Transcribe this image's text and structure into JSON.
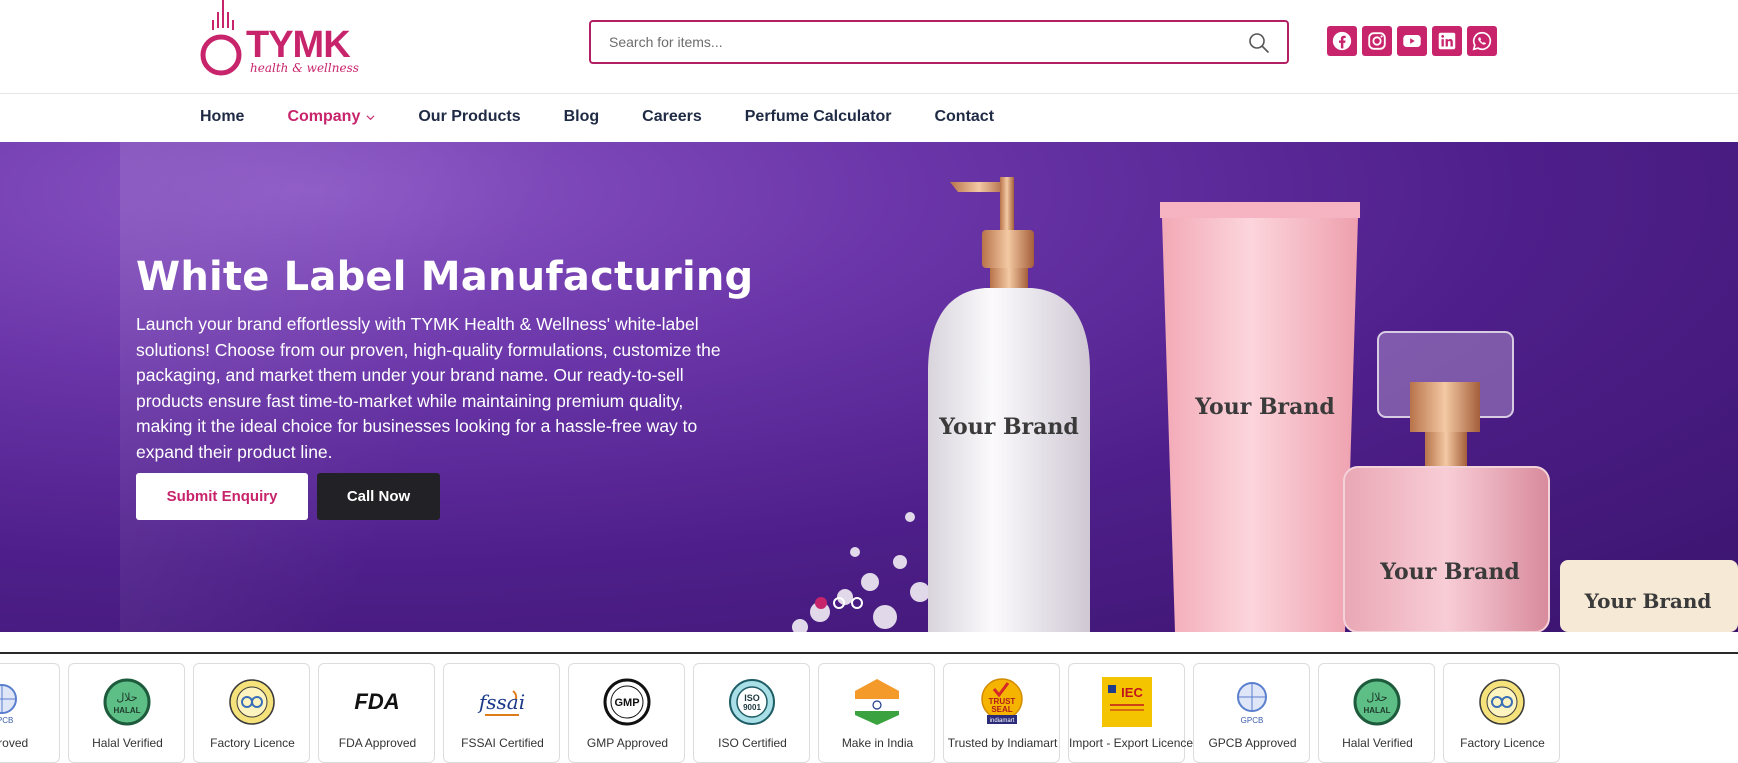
{
  "brand": {
    "name": "TYMK",
    "tagline": "health & wellness",
    "accent": "#c8246c"
  },
  "search": {
    "placeholder": "Search for items..."
  },
  "socials": [
    "facebook-icon",
    "instagram-icon",
    "youtube-icon",
    "linkedin-icon",
    "whatsapp-icon"
  ],
  "nav": {
    "items": [
      {
        "label": "Home"
      },
      {
        "label": "Company"
      },
      {
        "label": "Our Products"
      },
      {
        "label": "Blog"
      },
      {
        "label": "Careers"
      },
      {
        "label": "Perfume Calculator"
      },
      {
        "label": "Contact"
      }
    ]
  },
  "hero": {
    "title": "White Label Manufacturing",
    "text": "Launch your brand effortlessly with TYMK Health & Wellness' white-label solutions! Choose from our proven, high-quality formulations, customize the packaging, and market them under your brand name. Our ready-to-sell products ensure fast time-to-market while maintaining premium quality, making it the ideal choice for businesses looking for a hassle-free way to expand their product line.",
    "enquiry_label": "Submit Enquiry",
    "call_label": "Call Now",
    "product_brand_text": "Your Brand"
  },
  "certs": [
    {
      "label": "Approved",
      "icon": "gpcb-icon"
    },
    {
      "label": "Halal Verified",
      "icon": "halal-icon"
    },
    {
      "label": "Factory Licence",
      "icon": "factory-licence-icon"
    },
    {
      "label": "FDA Approved",
      "icon": "fda-icon"
    },
    {
      "label": "FSSAI Certified",
      "icon": "fssai-icon"
    },
    {
      "label": "GMP Approved",
      "icon": "gmp-icon"
    },
    {
      "label": "ISO Certified",
      "icon": "iso-icon"
    },
    {
      "label": "Make in India",
      "icon": "india-flag-icon"
    },
    {
      "label": "Trusted by Indiamart",
      "icon": "trust-seal-icon"
    },
    {
      "label": "Import - Export Licence",
      "icon": "iec-icon"
    },
    {
      "label": "GPCB Approved",
      "icon": "gpcb-icon"
    },
    {
      "label": "Halal Verified",
      "icon": "halal-icon"
    },
    {
      "label": "Factory Licence",
      "icon": "factory-licence-icon"
    }
  ],
  "cert_icon_text": {
    "gpcb": "GPCB",
    "halal": "HALAL",
    "fda": "FDA",
    "fssai": "fssai",
    "gmp": "GMP",
    "iso": "ISO",
    "iso_num": "9001",
    "trust": "TRUST",
    "seal": "SEAL",
    "indiamart": "indiamart",
    "iec": "IEC"
  }
}
